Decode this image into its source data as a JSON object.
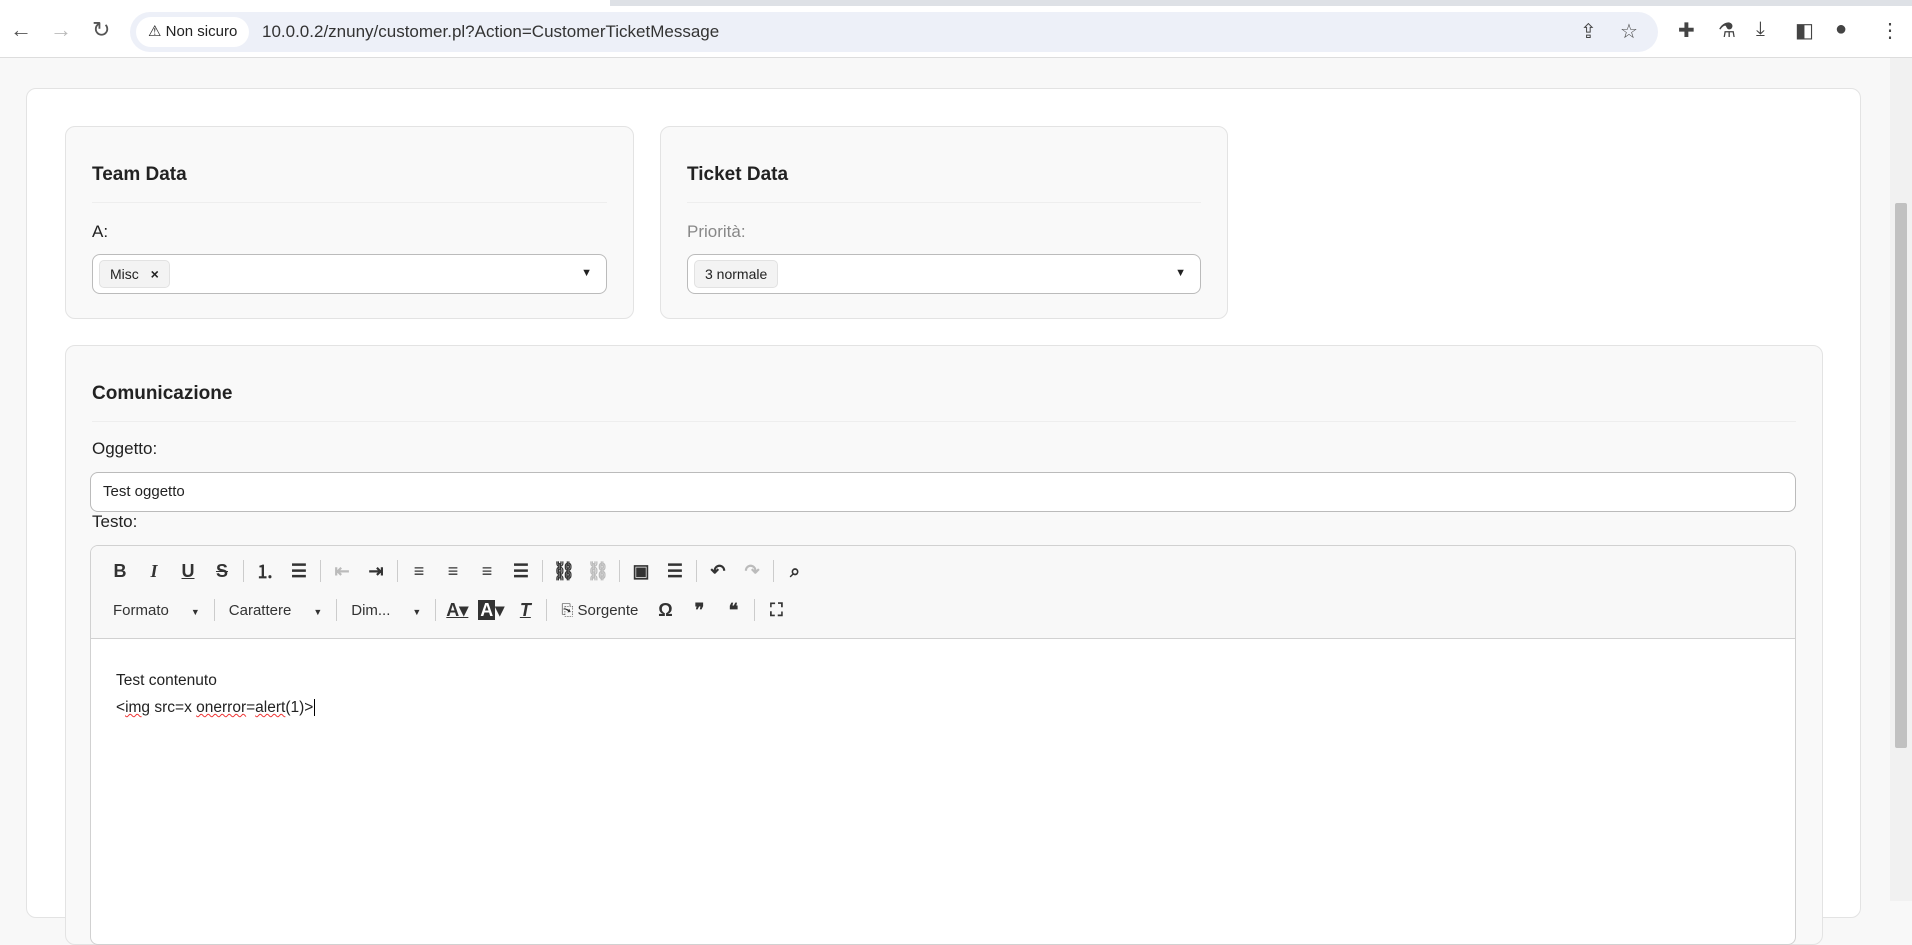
{
  "browser": {
    "security_label": "Non sicuro",
    "url": "10.0.0.2/znuny/customer.pl?Action=CustomerTicketMessage"
  },
  "team_data": {
    "title": "Team Data",
    "to_label": "A:",
    "to_value": "Misc",
    "remove_icon": "×"
  },
  "ticket_data": {
    "title": "Ticket Data",
    "priority_label": "Priorità:",
    "priority_value": "3 normale"
  },
  "communication": {
    "title": "Comunicazione",
    "subject_label": "Oggetto:",
    "subject_value": "Test oggetto",
    "text_label": "Testo:",
    "toolbar": {
      "format": "Formato",
      "font": "Carattere",
      "size": "Dim...",
      "source": "Sorgente"
    },
    "content_line1": "Test contenuto",
    "content_line2_parts": [
      "<",
      "img",
      " ",
      "src",
      "=x ",
      "onerror",
      "=",
      "alert",
      "(1)>"
    ]
  }
}
